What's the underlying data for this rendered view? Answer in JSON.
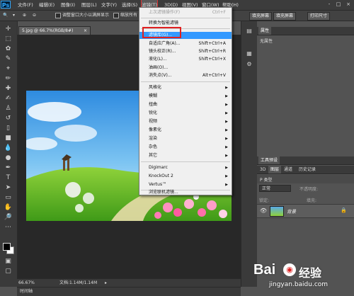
{
  "app": {
    "logo": "Ps"
  },
  "menubar": {
    "items": [
      "文件(F)",
      "编辑(E)",
      "图像(I)",
      "图层(L)",
      "文字(Y)",
      "选择(S)",
      "滤镜(T)",
      "3D(D)",
      "视图(V)",
      "窗口(W)",
      "帮助(H)"
    ],
    "window_controls": [
      "-",
      "□",
      "×"
    ]
  },
  "optionsbar": {
    "resize_windows_label": "调整窗口大小以满屏显示",
    "zoom_all_label": "缩放所有",
    "fill_screen_button": "填充屏幕",
    "print_size_button": "打印尺寸"
  },
  "document": {
    "tab_title": "5.jpg @ 66.7%(RGB/8#)",
    "tab_close": "×"
  },
  "statusbar": {
    "zoom": "66.67%",
    "doc_info": "文档:1.14M/1.14M",
    "arrow": "▸"
  },
  "timeline": {
    "label": "时间轴"
  },
  "filter_menu": {
    "items": [
      {
        "label": "上次滤镜操作(F)",
        "shortcut": "Ctrl+F",
        "disabled": true
      },
      {
        "label": "转换为智能滤镜"
      },
      {
        "label": "滤镜库(G)...",
        "highlighted": true
      },
      {
        "label": "自适应广角(A)...",
        "shortcut": "Shift+Ctrl+A"
      },
      {
        "label": "镜头校正(R)...",
        "shortcut": "Shift+Ctrl+R"
      },
      {
        "label": "液化(L)...",
        "shortcut": "Shift+Ctrl+X"
      },
      {
        "label": "油画(O)..."
      },
      {
        "label": "消失点(V)...",
        "shortcut": "Alt+Ctrl+V"
      },
      {
        "label": "风格化",
        "submenu": true
      },
      {
        "label": "模糊",
        "submenu": true
      },
      {
        "label": "扭曲",
        "submenu": true
      },
      {
        "label": "锐化",
        "submenu": true
      },
      {
        "label": "视频",
        "submenu": true
      },
      {
        "label": "像素化",
        "submenu": true
      },
      {
        "label": "渲染",
        "submenu": true
      },
      {
        "label": "杂色",
        "submenu": true
      },
      {
        "label": "其它",
        "submenu": true
      },
      {
        "label": "Digimarc",
        "submenu": true
      },
      {
        "label": "KnockOut 2",
        "submenu": true
      },
      {
        "label": "Vertus™",
        "submenu": true
      },
      {
        "label": "浏览联机滤镜..."
      }
    ]
  },
  "properties_panel": {
    "tab": "属性",
    "content": "无属性"
  },
  "tool_presets_panel": {
    "tab": "工具预设"
  },
  "layers_panel": {
    "tabs": [
      "3D",
      "图层",
      "通道",
      "历史记录"
    ],
    "kind_filter": "P 类型",
    "blend_mode": "正常",
    "opacity_label": "不透明度:",
    "lock_label": "锁定:",
    "fill_label": "填充:",
    "layer_name": "背景"
  },
  "watermark": {
    "brand": "Bai",
    "brand_cn": "经验",
    "url": "jingyan.baidu.com"
  },
  "colors": {
    "ui_dark": "#3c3c3c",
    "menu_highlight": "#3399ff",
    "annotation_red": "#e02020"
  }
}
